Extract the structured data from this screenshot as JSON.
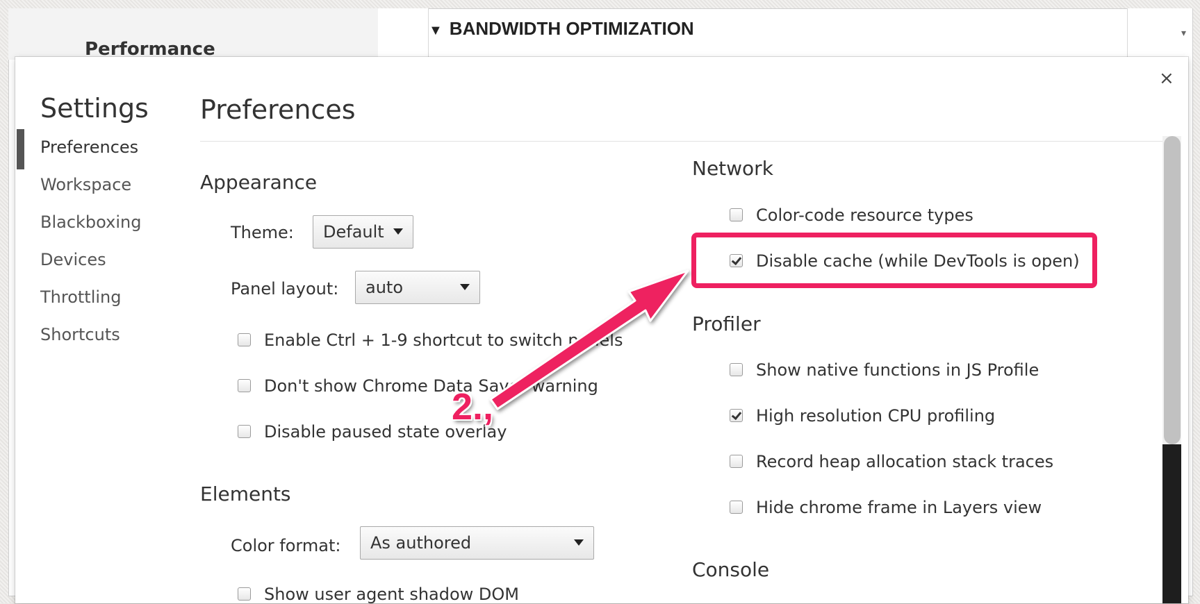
{
  "background": {
    "sidebar_label": "Performance",
    "header_title": "BANDWIDTH OPTIMIZATION",
    "header_icon": "triangle-down"
  },
  "dialog": {
    "title": "Settings",
    "close_label": "×",
    "nav": [
      {
        "label": "Preferences",
        "active": true
      },
      {
        "label": "Workspace"
      },
      {
        "label": "Blackboxing"
      },
      {
        "label": "Devices"
      },
      {
        "label": "Throttling"
      },
      {
        "label": "Shortcuts"
      }
    ],
    "page_title": "Preferences"
  },
  "appearance": {
    "title": "Appearance",
    "theme_label": "Theme:",
    "theme_value": "Default",
    "panel_layout_label": "Panel layout:",
    "panel_layout_value": "auto",
    "checks": [
      {
        "label": "Enable Ctrl + 1-9 shortcut to switch panels",
        "checked": false
      },
      {
        "label": "Don't show Chrome Data Saver warning",
        "checked": false
      },
      {
        "label": "Disable paused state overlay",
        "checked": false
      }
    ]
  },
  "elements": {
    "title": "Elements",
    "color_format_label": "Color format:",
    "color_format_value": "As authored",
    "checks": [
      {
        "label": "Show user agent shadow DOM",
        "checked": false
      }
    ]
  },
  "network": {
    "title": "Network",
    "checks": [
      {
        "label": "Color-code resource types",
        "checked": false
      },
      {
        "label": "Disable cache (while DevTools is open)",
        "checked": true
      }
    ]
  },
  "profiler": {
    "title": "Profiler",
    "checks": [
      {
        "label": "Show native functions in JS Profile",
        "checked": false
      },
      {
        "label": "High resolution CPU profiling",
        "checked": true
      },
      {
        "label": "Record heap allocation stack traces",
        "checked": false
      },
      {
        "label": "Hide chrome frame in Layers view",
        "checked": false
      }
    ]
  },
  "console": {
    "title": "Console"
  },
  "annotation": {
    "step_label": "2.,",
    "color": "#ee2060"
  }
}
